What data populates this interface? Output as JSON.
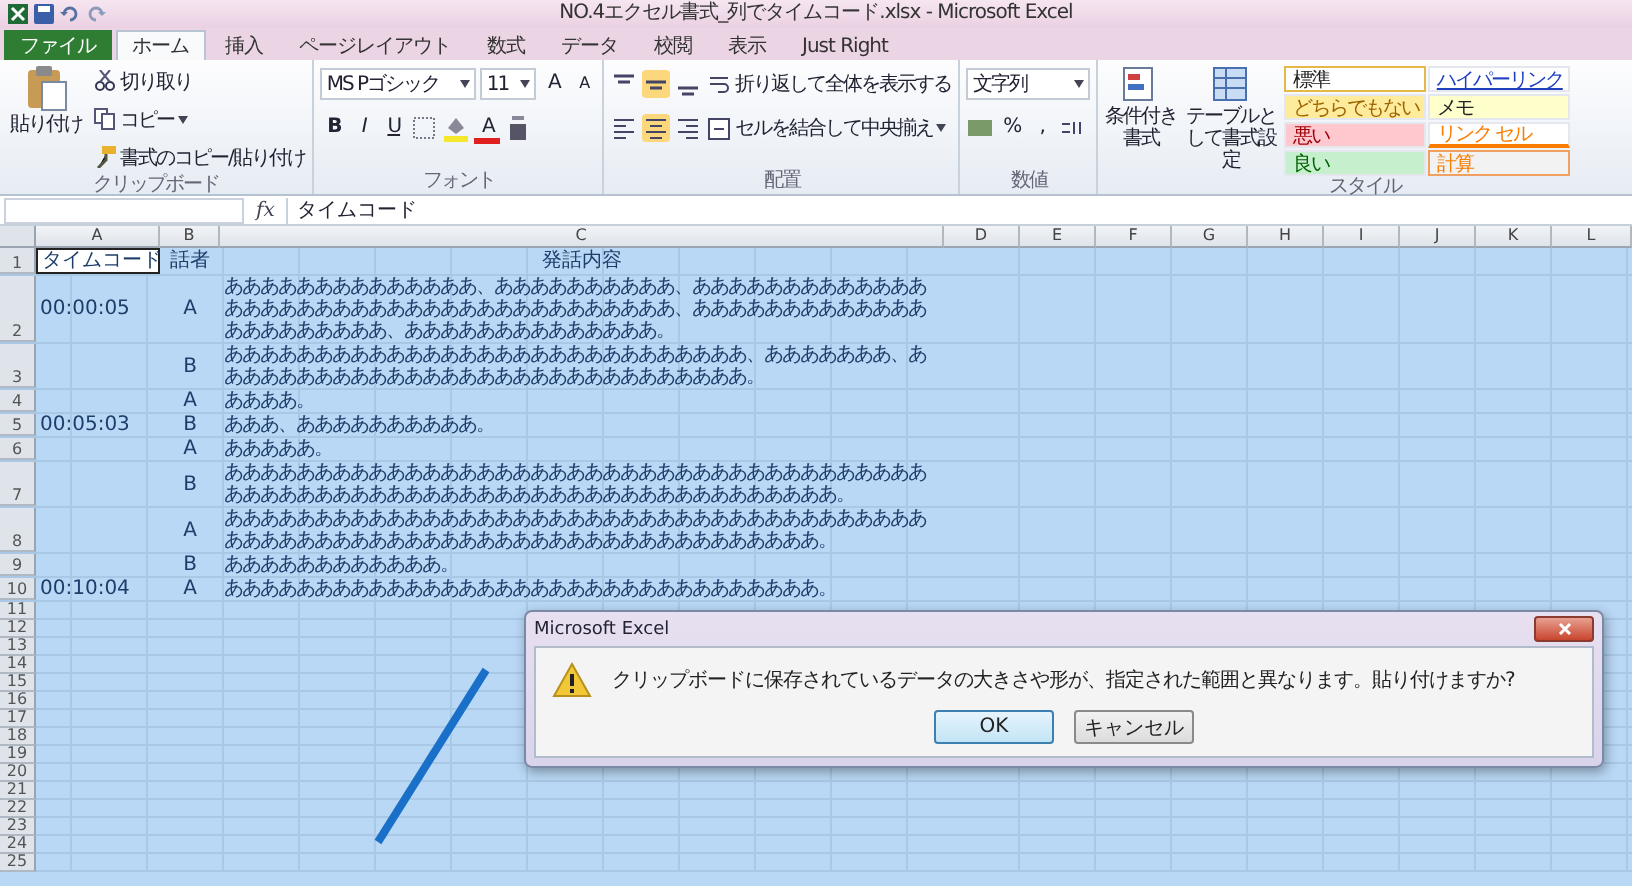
{
  "window": {
    "title": "NO.4エクセル書式_列でタイムコード.xlsx - Microsoft Excel"
  },
  "tabs": [
    {
      "label": "ファイル",
      "kind": "file",
      "selected": false
    },
    {
      "label": "ホーム",
      "kind": "tab",
      "selected": true
    },
    {
      "label": "挿入",
      "kind": "tab",
      "selected": false
    },
    {
      "label": "ページレイアウト",
      "kind": "tab",
      "selected": false
    },
    {
      "label": "数式",
      "kind": "tab",
      "selected": false
    },
    {
      "label": "データ",
      "kind": "tab",
      "selected": false
    },
    {
      "label": "校閲",
      "kind": "tab",
      "selected": false
    },
    {
      "label": "表示",
      "kind": "tab",
      "selected": false
    },
    {
      "label": "Just Right",
      "kind": "tab",
      "selected": false
    }
  ],
  "ribbon": {
    "clipboard": {
      "paste": "貼り付け",
      "cut": "切り取り",
      "copy": "コピー",
      "format_painter": "書式のコピー/貼り付け",
      "label": "クリップボード"
    },
    "font": {
      "name": "MS Pゴシック",
      "size": "11",
      "grow": "A",
      "shrink": "A",
      "bold": "B",
      "italic": "I",
      "underline": "U",
      "font_color": "A",
      "label": "フォント"
    },
    "alignment": {
      "wrap": "折り返して全体を表示する",
      "merge": "セルを結合して中央揃え",
      "label": "配置"
    },
    "number": {
      "format": "文字列",
      "percent": "%",
      "comma": ",",
      "label": "数値"
    },
    "styles": {
      "conditional": "条件付き書式",
      "table": "テーブルとして書式設定",
      "label": "スタイル",
      "cells": [
        {
          "label": "標準",
          "kind": "normal",
          "selected": true
        },
        {
          "label": "どちらでもない",
          "kind": "neutral",
          "selected": false
        },
        {
          "label": "悪い",
          "kind": "bad",
          "selected": false
        },
        {
          "label": "良い",
          "kind": "good",
          "selected": false
        },
        {
          "label": "ハイパーリンク",
          "kind": "hyperlink",
          "selected": false
        },
        {
          "label": "メモ",
          "kind": "note",
          "selected": false
        },
        {
          "label": "リンク セル",
          "kind": "linked",
          "selected": false
        },
        {
          "label": "計算",
          "kind": "calc",
          "selected": false
        }
      ]
    }
  },
  "formula_bar": {
    "function_label": "fx",
    "value": "タイムコード"
  },
  "columns": [
    "A",
    "B",
    "C",
    "D",
    "E",
    "F",
    "G",
    "H",
    "I",
    "J",
    "K",
    "L"
  ],
  "rows": [
    {
      "number": "1",
      "kind": "header",
      "time": "タイムコード",
      "speaker": "話者",
      "content": "発話内容",
      "selected": true
    },
    {
      "number": "2",
      "kind": "data",
      "time": "00:00:05",
      "speaker": "A",
      "content": "ああああああああああああああ、ああああああああああ、ああああああああああああああああああああああああああああああああああああああ、ああああああああああああああああああああああ、ああああああああああああああ。",
      "selected": false
    },
    {
      "number": "3",
      "kind": "data",
      "speaker": "B",
      "content": "あああああああああああああああああああああああああああああ、あああああああ、ああああああああああああああああああああああああああああああ。",
      "selected": false
    },
    {
      "number": "4",
      "kind": "data",
      "speaker": "A",
      "content": "ああああ。",
      "selected": false
    },
    {
      "number": "5",
      "kind": "data",
      "time": "00:05:03",
      "speaker": "B",
      "content": "あああ、ああああああああああ。",
      "selected": false
    },
    {
      "number": "6",
      "kind": "data",
      "speaker": "A",
      "content": "あああああ。",
      "selected": false
    },
    {
      "number": "7",
      "kind": "data",
      "speaker": "B",
      "content": "あああああああああああああああああああああああああああああああああああああああああああああああああああああああああああああああああああああああああ。",
      "selected": false
    },
    {
      "number": "8",
      "kind": "data",
      "speaker": "A",
      "content": "ああああああああああああああああああああああああああああああああああああああああああああああああああああああああああああああああああああああああ。",
      "selected": false
    },
    {
      "number": "9",
      "kind": "data",
      "speaker": "B",
      "content": "ああああああああああああ。",
      "selected": false
    },
    {
      "number": "10",
      "kind": "data",
      "time": "00:10:04",
      "speaker": "A",
      "content": "あああああああああああああああああああああああああああああああああ。",
      "selected": false
    }
  ],
  "empty_rows": [
    "11",
    "12",
    "13",
    "14",
    "15",
    "16",
    "17",
    "18",
    "19",
    "20",
    "21",
    "22",
    "23",
    "24",
    "25"
  ],
  "dialog": {
    "title": "Microsoft Excel",
    "message": "クリップボードに保存されているデータの大きさや形が、指定された範囲と異なります。貼り付けますか?",
    "buttons": [
      {
        "label": "OK",
        "selected": true
      },
      {
        "label": "キャンセル",
        "selected": false
      }
    ]
  }
}
